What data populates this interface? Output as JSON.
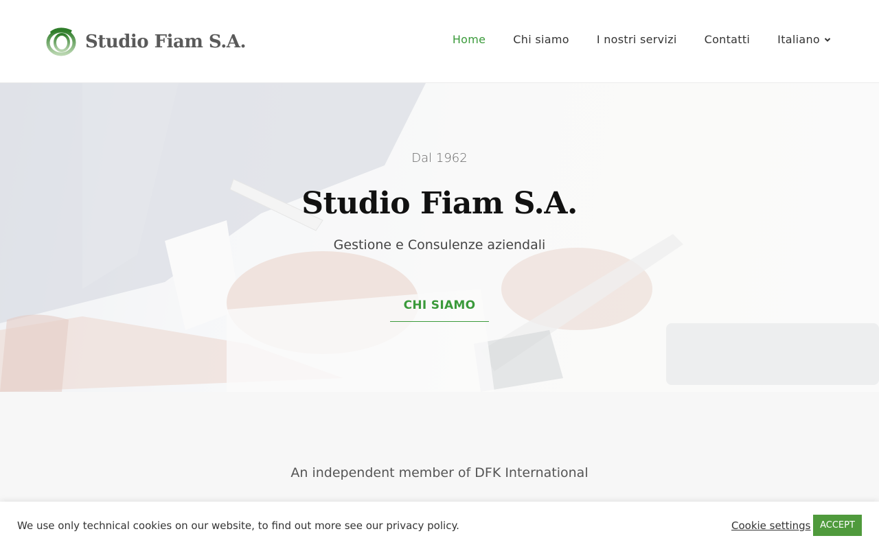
{
  "brand": {
    "name": "Studio Fiam S.A.",
    "logo_icon": "spiral-logo-icon",
    "accent_color": "#3a9a3a"
  },
  "nav": {
    "items": [
      {
        "label": "Home",
        "active": true
      },
      {
        "label": "Chi siamo",
        "active": false
      },
      {
        "label": "I nostri servizi",
        "active": false
      },
      {
        "label": "Contatti",
        "active": false
      }
    ],
    "language": {
      "label": "Italiano",
      "icon": "chevron-down-icon"
    }
  },
  "hero": {
    "kicker": "Dal 1962",
    "title": "Studio Fiam S.A.",
    "subtitle": "Gestione e Consulenze aziendali",
    "cta_label": "CHI SIAMO"
  },
  "member": {
    "text": "An independent member of DFK International"
  },
  "cookie": {
    "text": "We use only technical cookies on our website, to find out more see our privacy policy.",
    "settings_label": "Cookie settings",
    "accept_label": "ACCEPT",
    "accept_color": "#4f9a3c"
  }
}
